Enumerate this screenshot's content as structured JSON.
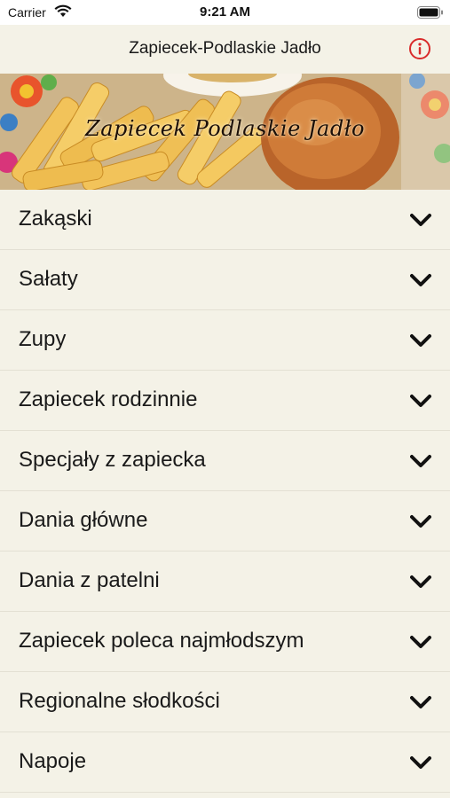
{
  "status_bar": {
    "carrier": "Carrier",
    "time": "9:21 AM"
  },
  "nav": {
    "title": "Zapiecek-Podlaskie Jadło",
    "info_icon": "info-circle-icon",
    "accent_color": "#d92b2b"
  },
  "banner": {
    "script_text": "Zapiecek Podlaskie Jadło"
  },
  "menu": {
    "items": [
      {
        "label": "Zakąski"
      },
      {
        "label": "Sałaty"
      },
      {
        "label": "Zupy"
      },
      {
        "label": "Zapiecek rodzinnie"
      },
      {
        "label": "Specjały z zapiecka"
      },
      {
        "label": "Dania główne"
      },
      {
        "label": "Dania z patelni"
      },
      {
        "label": "Zapiecek poleca najmłodszym"
      },
      {
        "label": "Regionalne słodkości"
      },
      {
        "label": "Napoje"
      }
    ],
    "chevron_icon": "chevron-down-icon"
  }
}
